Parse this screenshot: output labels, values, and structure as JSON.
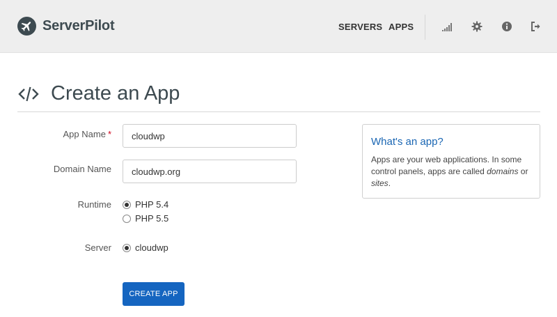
{
  "header": {
    "brand": "ServerPilot",
    "nav": [
      {
        "label": "SERVERS"
      },
      {
        "label": "APPS"
      }
    ],
    "icons": [
      "signal-icon",
      "gear-icon",
      "info-icon",
      "logout-icon"
    ]
  },
  "page": {
    "title": "Create an App"
  },
  "form": {
    "app_name": {
      "label": "App Name",
      "required_mark": "*",
      "value": "cloudwp"
    },
    "domain_name": {
      "label": "Domain Name",
      "value": "cloudwp.org"
    },
    "runtime": {
      "label": "Runtime",
      "options": [
        {
          "label": "PHP 5.4",
          "checked": true
        },
        {
          "label": "PHP 5.5",
          "checked": false
        }
      ]
    },
    "server": {
      "label": "Server",
      "options": [
        {
          "label": "cloudwp",
          "checked": true
        }
      ]
    },
    "submit_label": "CREATE APP"
  },
  "info_box": {
    "title": "What's an app?",
    "body_prefix": "Apps are your web applications. In some control panels, apps are called ",
    "em1": "domains",
    "mid": " or ",
    "em2": "sites",
    "suffix": "."
  },
  "colors": {
    "header_bg": "#eeeeee",
    "brand": "#3d4a50",
    "button": "#1565c0",
    "link": "#1a66b3",
    "required": "#d0021b"
  }
}
